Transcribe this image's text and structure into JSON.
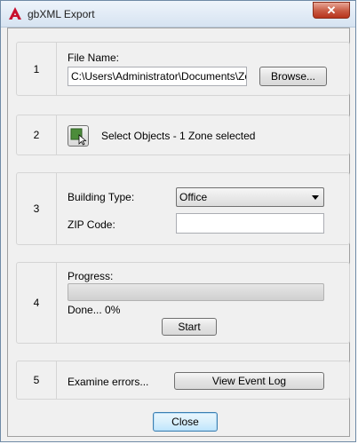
{
  "window": {
    "title": "gbXML Export",
    "close_glyph": "✕"
  },
  "step1": {
    "number": "1",
    "label": "File Name:",
    "value": "C:\\Users\\Administrator\\Documents\\Zone",
    "browse_label": "Browse..."
  },
  "step2": {
    "number": "2",
    "select_text": "Select Objects - 1 Zone selected",
    "icon": "select-objects-icon"
  },
  "step3": {
    "number": "3",
    "building_type_label": "Building Type:",
    "building_type_value": "Office",
    "zip_label": "ZIP Code:",
    "zip_value": ""
  },
  "step4": {
    "number": "4",
    "progress_label": "Progress:",
    "progress_fraction": 0,
    "status_text": "Done... 0%",
    "start_label": "Start"
  },
  "step5": {
    "number": "5",
    "errors_label": "Examine errors...",
    "view_log_label": "View Event Log"
  },
  "footer": {
    "close_label": "Close"
  },
  "colors": {
    "app_icon": "#c8102e",
    "progress_fill": "#3cb371"
  }
}
